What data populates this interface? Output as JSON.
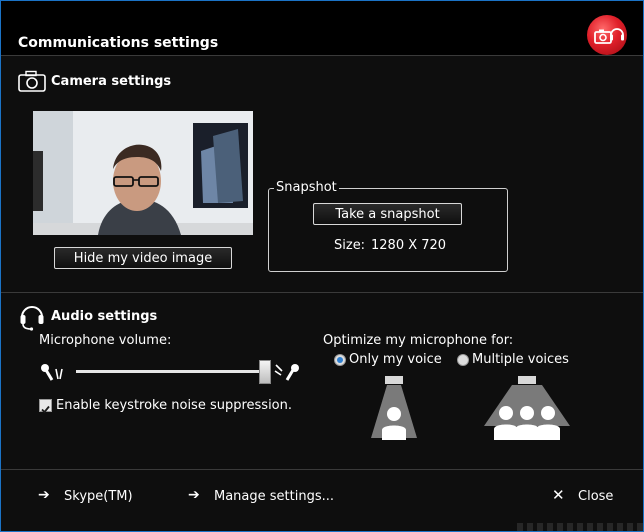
{
  "window": {
    "title": "Communications settings"
  },
  "camera": {
    "heading": "Camera settings",
    "hide_video_label": "Hide my video image",
    "snapshot": {
      "legend": "Snapshot",
      "take_label": "Take a snapshot",
      "size_label": "Size:",
      "size_value": "1280 X 720"
    }
  },
  "audio": {
    "heading": "Audio settings",
    "mic_volume_label": "Microphone volume:",
    "mic_volume_level": 0.93,
    "noise_suppression_label": "Enable keystroke noise suppression.",
    "noise_suppression_checked": true,
    "optimize_label": "Optimize my microphone for:",
    "options": [
      {
        "label": "Only my voice",
        "selected": true
      },
      {
        "label": "Multiple voices",
        "selected": false
      }
    ]
  },
  "footer": {
    "skype_label": "Skype(TM)",
    "manage_label": "Manage settings...",
    "close_label": "Close"
  },
  "colors": {
    "accent": "#1b73c6",
    "badge": "#e0202a",
    "radio_selected": "#2f7fd0"
  }
}
